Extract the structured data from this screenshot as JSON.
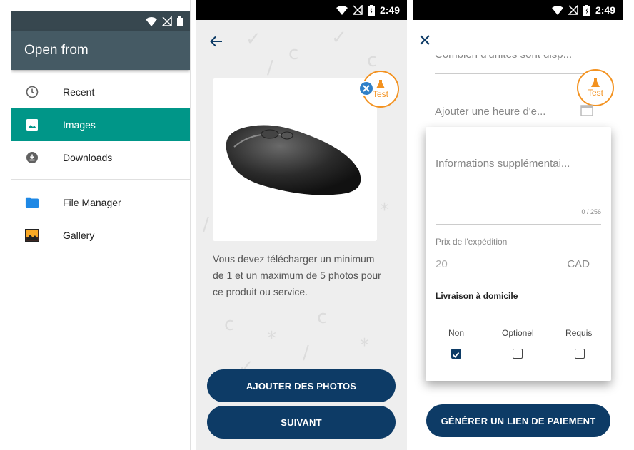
{
  "panel1": {
    "title": "Open from",
    "items": [
      {
        "label": "Recent",
        "icon": "clock-icon"
      },
      {
        "label": "Images",
        "icon": "image-icon",
        "selected": true
      },
      {
        "label": "Downloads",
        "icon": "download-icon"
      },
      {
        "label": "File Manager",
        "icon": "folder-icon"
      },
      {
        "label": "Gallery",
        "icon": "gallery-icon"
      }
    ],
    "colors": {
      "appbar": "#455a64",
      "selected": "#009688"
    }
  },
  "panel2": {
    "status_time": "2:49",
    "test_badge": "Test",
    "description": "Vous devez télécharger un minimum de 1 et un maximum de 5 photos pour ce produit ou service.",
    "buttons": {
      "add_photos": "AJOUTER DES PHOTOS",
      "next": "SUIVANT"
    },
    "colors": {
      "primary": "#0d3b66",
      "badge": "#f39220"
    }
  },
  "panel3": {
    "status_time": "2:49",
    "test_badge": "Test",
    "units_field": "Combien d'unités sont disp...",
    "time_field": "Ajouter une heure d'e...",
    "info_field": "Informations supplémentai...",
    "char_count": "0 / 256",
    "shipping_label": "Prix de l'expédition",
    "shipping_value": "20",
    "currency": "CAD",
    "delivery_title": "Livraison à domicile",
    "options": [
      {
        "label": "Non",
        "checked": true
      },
      {
        "label": "Optionel",
        "checked": false
      },
      {
        "label": "Requis",
        "checked": false
      }
    ],
    "generate_button": "GÉNÉRER UN LIEN DE PAIEMENT"
  }
}
